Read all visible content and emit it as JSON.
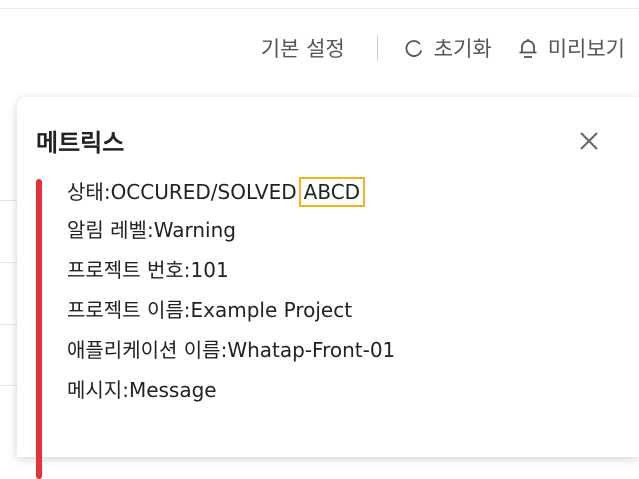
{
  "toolbar": {
    "default_settings_label": "기본 설정",
    "reset_label": "초기화",
    "preview_label": "미리보기"
  },
  "panel": {
    "title": "메트릭스",
    "rows": [
      {
        "label": "상태",
        "value": "OCCURED/SOLVED",
        "highlight": "ABCD"
      },
      {
        "label": "알림 레벨",
        "value": "Warning"
      },
      {
        "label": "프로젝트 번호",
        "value": "101"
      },
      {
        "label": "프로젝트 이름",
        "value": "Example Project"
      },
      {
        "label": "애플리케이션 이름",
        "value": "Whatap-Front-01"
      },
      {
        "label": "메시지",
        "value": "Message"
      }
    ],
    "accent_color": "#e6303a",
    "highlight_color": "#f2b51b"
  },
  "icons": [
    "reset-icon",
    "bell-icon",
    "close-icon"
  ]
}
